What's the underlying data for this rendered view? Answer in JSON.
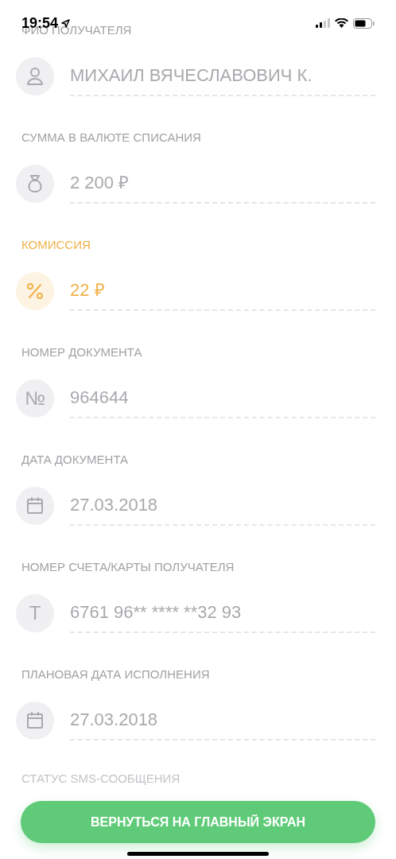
{
  "status_bar": {
    "time": "19:54"
  },
  "fields": [
    {
      "label": "ФИО ПОЛУЧАТЕЛЯ",
      "kind": "person",
      "value": "МИХАИЛ ВЯЧЕСЛАВОВИЧ К.",
      "highlighted": false
    },
    {
      "label": "СУММА В ВАЛЮТЕ СПИСАНИЯ",
      "kind": "moneybag",
      "value": "2 200 ₽",
      "highlighted": false
    },
    {
      "label": "КОМИССИЯ",
      "kind": "percent",
      "value": "22 ₽",
      "highlighted": true
    },
    {
      "label": "НОМЕР ДОКУМЕНТА",
      "kind": "glyph",
      "glyph": "№",
      "value": "964644",
      "highlighted": false
    },
    {
      "label": "ДАТА ДОКУМЕНТА",
      "kind": "calendar",
      "value": "27.03.2018",
      "highlighted": false
    },
    {
      "label": "НОМЕР СЧЕТА/КАРТЫ ПОЛУЧАТЕЛЯ",
      "kind": "glyph",
      "glyph": "T",
      "value": "6761 96** **** **32 93",
      "highlighted": false
    },
    {
      "label": "ПЛАНОВАЯ ДАТА ИСПОЛНЕНИЯ",
      "kind": "calendar",
      "value": "27.03.2018",
      "highlighted": false
    }
  ],
  "faded_label": "СТАТУС SMS-СООБЩЕНИЯ",
  "button": "ВЕРНУТЬСЯ НА ГЛАВНЫЙ ЭКРАН"
}
